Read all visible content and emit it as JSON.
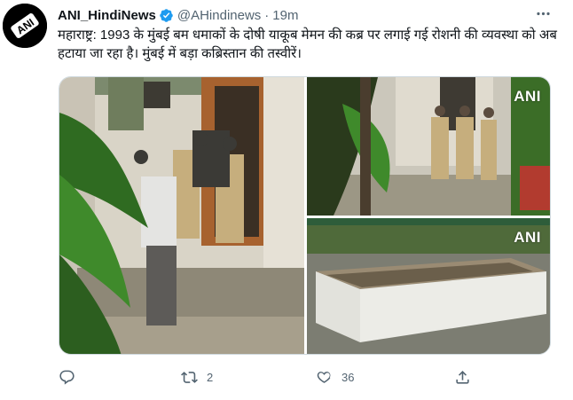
{
  "tweet": {
    "display_name": "ANI_HindiNews",
    "verified_icon": "verified-badge-icon",
    "handle": "@AHindinews",
    "separator": "·",
    "time": "19m",
    "more_icon": "more-options-icon",
    "avatar_text": "ANI",
    "text": "महाराष्ट्र: 1993 के मुंबई बम धमाकों के दोषी याकूब मेमन की कब्र पर लगाई गई रोशनी की व्यवस्था को अब हटाया जा रहा है। मुंबई में बड़ा कब्रिस्तान की तस्वीरें।",
    "media": [
      {
        "name": "photo-policemen-at-graveyard-gate",
        "badge": ""
      },
      {
        "name": "photo-policemen-near-trees",
        "badge": "ANI"
      },
      {
        "name": "photo-tiled-grave",
        "badge": "ANI"
      }
    ],
    "actions": {
      "reply_icon": "reply-icon",
      "reply_count": "",
      "retweet_icon": "retweet-icon",
      "retweet_count": "2",
      "like_icon": "heart-icon",
      "like_count": "36",
      "share_icon": "share-icon"
    }
  },
  "colors": {
    "primary_text": "#0f1419",
    "secondary_text": "#536471",
    "verified_blue": "#1d9bf0",
    "border": "#cfd9de"
  }
}
